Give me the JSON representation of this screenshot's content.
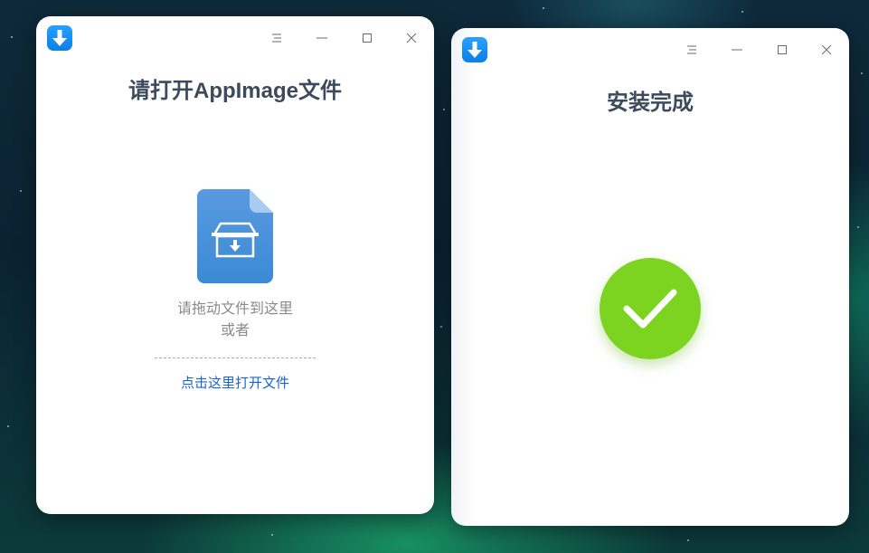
{
  "windows": {
    "left": {
      "title": "请打开AppImage文件",
      "drag_hint_line1": "请拖动文件到这里",
      "drag_hint_line2": "或者",
      "open_link": "点击这里打开文件"
    },
    "right": {
      "title": "安装完成"
    }
  },
  "icons": {
    "app": "download-arrow-icon",
    "menu": "menu-icon",
    "minimize": "minimize-icon",
    "maximize": "maximize-icon",
    "close": "close-icon",
    "file": "appimage-file-icon",
    "success": "checkmark-icon"
  },
  "colors": {
    "accent": "#0a7fe6",
    "link": "#1a63d6",
    "success": "#7dd420",
    "title": "#3d4a5c"
  }
}
